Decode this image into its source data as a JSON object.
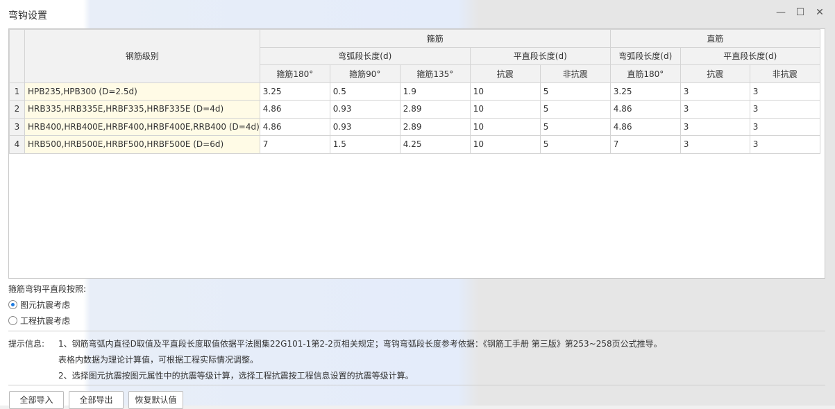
{
  "window": {
    "title": "弯钩设置",
    "minimize": "—",
    "maximize": "☐",
    "close": "✕"
  },
  "table": {
    "h_grade": "钢筋级别",
    "h_stirrup": "箍筋",
    "h_straight": "直筋",
    "h_arc": "弯弧段长度(d)",
    "h_flat": "平直段长度(d)",
    "h_arc2": "弯弧段长度(d)",
    "h_flat2": "平直段长度(d)",
    "sub": [
      "箍筋180°",
      "箍筋90°",
      "箍筋135°",
      "抗震",
      "非抗震",
      "直筋180°",
      "抗震",
      "非抗震"
    ],
    "rows": [
      {
        "n": "1",
        "grade": "HPB235,HPB300 (D=2.5d)",
        "v": [
          "3.25",
          "0.5",
          "1.9",
          "10",
          "5",
          "3.25",
          "3",
          "3"
        ]
      },
      {
        "n": "2",
        "grade": "HRB335,HRB335E,HRBF335,HRBF335E (D=4d)",
        "v": [
          "4.86",
          "0.93",
          "2.89",
          "10",
          "5",
          "4.86",
          "3",
          "3"
        ]
      },
      {
        "n": "3",
        "grade": "HRB400,HRB400E,HRBF400,HRBF400E,RRB400 (D=4d)",
        "v": [
          "4.86",
          "0.93",
          "2.89",
          "10",
          "5",
          "4.86",
          "3",
          "3"
        ]
      },
      {
        "n": "4",
        "grade": "HRB500,HRB500E,HRBF500,HRBF500E (D=6d)",
        "v": [
          "7",
          "1.5",
          "4.25",
          "10",
          "5",
          "7",
          "3",
          "3"
        ]
      }
    ]
  },
  "options": {
    "label": "箍筋弯钩平直段按照:",
    "opt1": "图元抗震考虑",
    "opt2": "工程抗震考虑",
    "selected": "图元抗震考虑"
  },
  "tips": {
    "label": "提示信息:",
    "line1": "1、钢筋弯弧内直径D取值及平直段长度取值依据平法图集22G101-1第2-2页相关规定；弯钩弯弧段长度参考依据：《钢筋工手册 第三版》第253~258页公式推导。",
    "line2": "表格内数据为理论计算值，可根据工程实际情况调整。",
    "line3": "2、选择图元抗震按图元属性中的抗震等级计算，选择工程抗震按工程信息设置的抗震等级计算。"
  },
  "buttons": {
    "import": "全部导入",
    "export": "全部导出",
    "restore": "恢复默认值"
  }
}
